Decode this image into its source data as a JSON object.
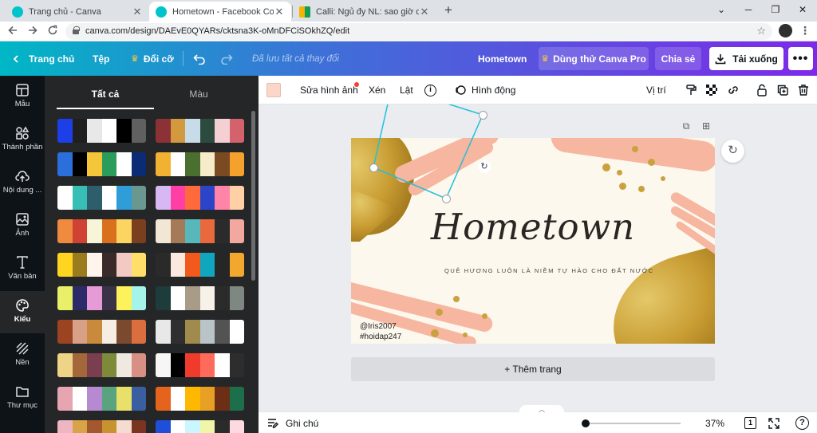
{
  "browser": {
    "tabs": [
      {
        "title": "Trang chủ - Canva",
        "close": "✕"
      },
      {
        "title": "Hometown - Facebook Cover",
        "close": "✕"
      },
      {
        "title": "Calli: Ngủ đy NL: sao giờ chua ng",
        "close": "✕"
      }
    ],
    "new_tab": "+",
    "url": "canva.com/design/DAEvE0QYARs/cktsna3K-oMnDFCiSOkhZQ/edit",
    "window_controls": [
      "⌄",
      "─",
      "❐",
      "✕"
    ]
  },
  "header": {
    "home": "Trang chủ",
    "file": "Tệp",
    "resize": "Đổi cỡ",
    "saved": "Đã lưu tất cả thay đổi",
    "doc_title": "Hometown",
    "try_pro": "Dùng thử Canva Pro",
    "share": "Chia sẻ",
    "download": "Tải xuống",
    "more": "•••"
  },
  "rail": {
    "items": [
      {
        "label": "Mẫu",
        "icon": "templates-icon"
      },
      {
        "label": "Thành phần",
        "icon": "elements-icon"
      },
      {
        "label": "Nội dung ...",
        "icon": "uploads-icon"
      },
      {
        "label": "Ảnh",
        "icon": "photos-icon"
      },
      {
        "label": "Văn bản",
        "icon": "text-icon"
      },
      {
        "label": "Kiểu",
        "icon": "styles-icon"
      },
      {
        "label": "Nền",
        "icon": "background-icon"
      },
      {
        "label": "Thư mục",
        "icon": "folder-icon"
      }
    ]
  },
  "panel": {
    "tabs": [
      "Tất cả",
      "Màu"
    ],
    "palettes": [
      [
        "#1c3fe8",
        "#1f1f1f",
        "#e8e8e8",
        "#ffffff",
        "#000000",
        "#606060"
      ],
      [
        "#8c3236",
        "#d29a3c",
        "#c8dbe8",
        "#2d4a3e",
        "#f4d0d5",
        "#d4626d"
      ],
      [
        "#2a6fdb",
        "#000000",
        "#f6c63a",
        "#2b9c5b",
        "#ffffff",
        "#0b2b74"
      ],
      [
        "#f1b132",
        "#ffffff",
        "#4a6f2f",
        "#f7ecc9",
        "#7a4a22",
        "#f4a12e"
      ],
      [
        "#ffffff",
        "#37bfb6",
        "#2e5e6c",
        "#ffffff",
        "#2f9dd7",
        "#6a978f"
      ],
      [
        "#d8b8f2",
        "#ff3fa6",
        "#ff6a3d",
        "#2c45c8",
        "#ff85a8",
        "#ffd0a5"
      ],
      [
        "#f08a3e",
        "#cf4234",
        "#f8f4d8",
        "#d9701d",
        "#fbd462",
        "#7a3f1d"
      ],
      [
        "#f2e6d4",
        "#a47a58",
        "#58b7bb",
        "#e8693c",
        "#2b2b2b",
        "#f2a89f"
      ],
      [
        "#ffd522",
        "#9a7b1d",
        "#fff5ec",
        "#3b2a2a",
        "#f3c9c3",
        "#ffdf69"
      ],
      [
        "#2a2a2a",
        "#fbe9e0",
        "#f25a1d",
        "#10a6c0",
        "#262626",
        "#f2a82f"
      ],
      [
        "#e8f06a",
        "#2c2a68",
        "#e69bd7",
        "#3a3348",
        "#fdf25c",
        "#a6f3ea"
      ],
      [
        "#1e3c3a",
        "#ffffff",
        "#a89b87",
        "#f6f2ea",
        "#2b2b2b",
        "#7e8781"
      ],
      [
        "#9c4321",
        "#d8a187",
        "#c98a3b",
        "#f6ede3",
        "#7b4a2e",
        "#da6e3f"
      ],
      [
        "#e8e8e8",
        "#2f2f2f",
        "#a08a4e",
        "#b8c4c8",
        "#535353",
        "#ffffff"
      ],
      [
        "#efd487",
        "#a4673a",
        "#7a3e4e",
        "#7d8a3a",
        "#efe9e0",
        "#d88f84"
      ],
      [
        "#f6f6f6",
        "#000000",
        "#ef3b2c",
        "#ff6b5b",
        "#ffffff",
        "#2d2d2d"
      ],
      [
        "#e7a5b2",
        "#ffffff",
        "#b58ad0",
        "#5aa37f",
        "#e9e06a",
        "#3a5fa1"
      ],
      [
        "#e4641e",
        "#ffffff",
        "#ffb800",
        "#e8a024",
        "#6c2f15",
        "#1d6e4a"
      ],
      [
        "#eeb6c2",
        "#d7a44a",
        "#a3592d",
        "#c7932e",
        "#f4ddd0",
        "#7a3522"
      ],
      [
        "#1f4fd8",
        "#ffffff",
        "#cbf5ff",
        "#f0f5a8",
        "#2b2b2b",
        "#ffd9e0"
      ]
    ]
  },
  "toolbar": {
    "edit_image": "Sửa hình ảnh",
    "crop": "Xén",
    "flip": "Lật",
    "info": "i",
    "animate": "Hình động",
    "position": "Vị trí",
    "swatch_color": "#fcd6c8"
  },
  "design": {
    "title": "Hometown",
    "subtitle": "QUÊ HƯƠNG LUÔN LÀ NIỀM TỰ HÀO CHO ĐẤT NƯỚC",
    "credit1": "@Iris2007",
    "credit2": "#hoidap247",
    "add_page": "+ Thêm trang"
  },
  "footer": {
    "notes": "Ghi chú",
    "zoom": "37%",
    "page": "1",
    "help": "?"
  }
}
